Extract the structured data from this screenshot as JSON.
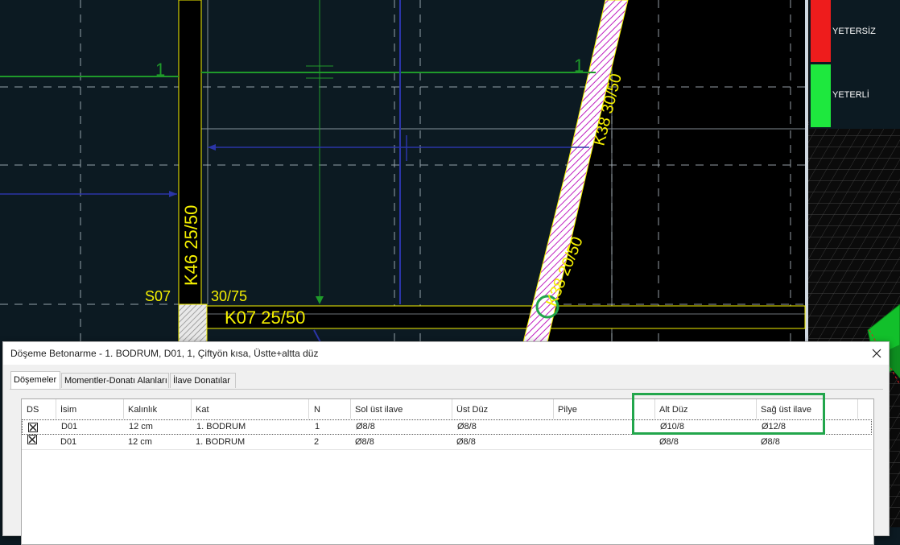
{
  "cad": {
    "labels": {
      "k46": "K46   25/50",
      "s07": "S07",
      "col_size": "30/75",
      "k07": "K07   25/50",
      "slab_left": "1",
      "slab_right": "1",
      "diag_beam_1": "K38 20/50",
      "diag_beam_2": "K38 30/50"
    },
    "colors": {
      "background": "#0c1a22",
      "beam_label": "#f5f000",
      "green_line": "#1f9a2a",
      "blue_line": "#2b35a8",
      "grid": "#b8c4cc",
      "wall": "#e5e5e5",
      "selection": "#22a64c"
    }
  },
  "legend": {
    "items": [
      {
        "label": "YETERSİZ",
        "color": "#ee1c1c"
      },
      {
        "label": "YETERLİ",
        "color": "#1ee83e"
      }
    ]
  },
  "dialog": {
    "title": "Döşeme Betonarme - 1. BODRUM, D01, 1, Çiftyön kısa, Üstte+altta düz",
    "close_icon": "close-icon",
    "tabs": [
      {
        "label": "Döşemeler",
        "active": true
      },
      {
        "label": "Momentler-Donatı Alanları",
        "active": false
      },
      {
        "label": "İlave Donatılar",
        "active": false
      }
    ],
    "table": {
      "columns": [
        "DS",
        "İsim",
        "Kalınlık",
        "Kat",
        "N",
        "Sol üst ilave",
        "Üst Düz",
        "Pilye",
        "Alt Düz",
        "Sağ üst ilave"
      ],
      "rows": [
        {
          "ds": "checked",
          "isim": "D01",
          "kalinlik": "12 cm",
          "kat": "1. BODRUM",
          "n": "1",
          "sol_ust_ilave": "Ø8/8",
          "ust_duz": "Ø8/8",
          "pilye": "",
          "alt_duz": "Ø10/8",
          "sag_ust_ilave": "Ø12/8",
          "selected": true
        },
        {
          "ds": "checked",
          "isim": "D01",
          "kalinlik": "12 cm",
          "kat": "1. BODRUM",
          "n": "2",
          "sol_ust_ilave": "Ø8/8",
          "ust_duz": "Ø8/8",
          "pilye": "",
          "alt_duz": "Ø8/8",
          "sag_ust_ilave": "Ø8/8",
          "selected": false
        }
      ]
    }
  }
}
